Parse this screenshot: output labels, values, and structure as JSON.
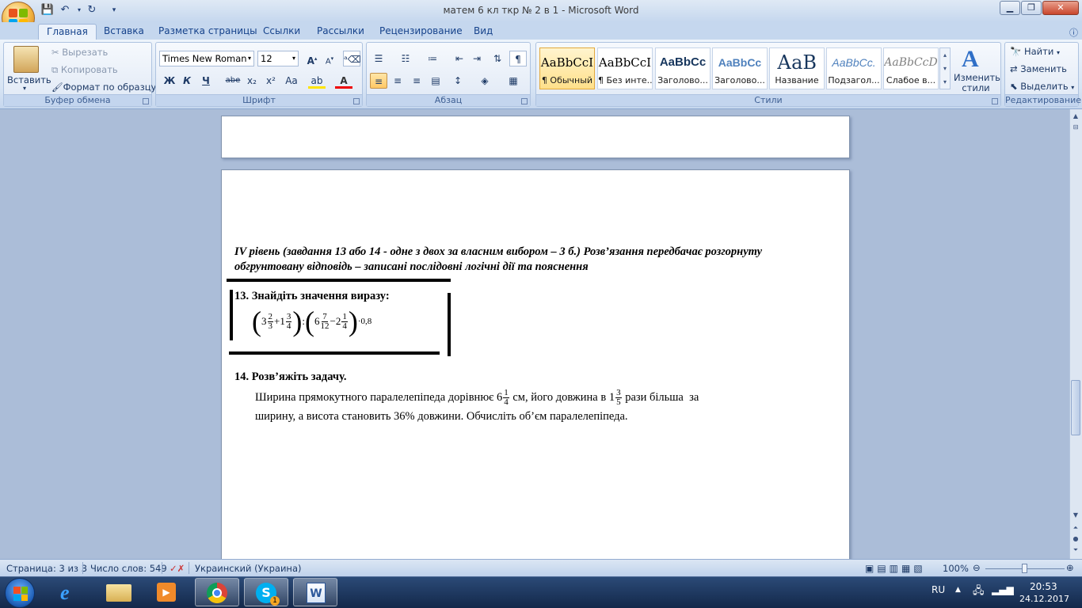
{
  "window": {
    "title": "матем 6 кл ткр № 2 в 1  -  Microsoft Word"
  },
  "tabs": [
    "Главная",
    "Вставка",
    "Разметка страницы",
    "Ссылки",
    "Рассылки",
    "Рецензирование",
    "Вид"
  ],
  "clipboard": {
    "paste": "Вставить",
    "cut": "Вырезать",
    "copy": "Копировать",
    "format_painter": "Формат по образцу",
    "label": "Буфер обмена"
  },
  "font": {
    "name": "Times New Roman",
    "size": "12",
    "label": "Шрифт",
    "bold": "Ж",
    "italic": "К",
    "underline": "Ч",
    "strike": "abe",
    "sub": "x₂",
    "sup": "x²",
    "case": "Aa"
  },
  "paragraph": {
    "label": "Абзац"
  },
  "styles": {
    "items": [
      {
        "preview": "AaBbCcI",
        "name": "¶ Обычный"
      },
      {
        "preview": "AaBbCcI",
        "name": "¶ Без инте..."
      },
      {
        "preview": "AaBbCc",
        "name": "Заголово..."
      },
      {
        "preview": "AaBbCc",
        "name": "Заголово..."
      },
      {
        "preview": "АаВ",
        "name": "Название"
      },
      {
        "preview": "AaBbCc.",
        "name": "Подзагол..."
      },
      {
        "preview": "AaBbCcD",
        "name": "Слабое в..."
      }
    ],
    "change": "Изменить стили",
    "label": "Стили"
  },
  "editing": {
    "find": "Найти",
    "replace": "Заменить",
    "select": "Выделить",
    "label": "Редактирование"
  },
  "document": {
    "level_heading": "IV рівень (завдання 13 або 14 - одне з двох за власним вибором – 3 б.) Розв’язання передбачає розгорнуту обгрунтовану відповідь  – записані послідовні логічні дії та пояснення",
    "task13_title": "13. Знайдіть значення виразу:",
    "expr": {
      "a_whole": "3",
      "a_num": "2",
      "a_den": "3",
      "plus": "+",
      "b_whole": "1",
      "b_num": "3",
      "b_den": "4",
      "div": ":",
      "c_whole": "6",
      "c_num": "7",
      "c_den": "12",
      "minus": "−",
      "d_whole": "2",
      "d_num": "1",
      "d_den": "4",
      "mult": "·0,8"
    },
    "task14_title": "14. Розв’яжіть задачу.",
    "task14_line1_a": "Ширина прямокутного паралелепіпеда дорівнює 6",
    "w_num": "1",
    "w_den": "4",
    "task14_line1_b": " см, його довжина в 1",
    "l_num": "3",
    "l_den": "5",
    "task14_line1_c": " рази більша  за",
    "task14_line2": "ширину, а висота становить 36% довжини. Обчисліть об’єм паралелепіпеда."
  },
  "status": {
    "page": "Страница: 3 из 3",
    "words": "Число слов: 549",
    "language": "Украинский (Украина)",
    "zoom": "100%"
  },
  "taskbar": {
    "lang": "RU",
    "time": "20:53",
    "date": "24.12.2017",
    "skype_badge": "1"
  }
}
